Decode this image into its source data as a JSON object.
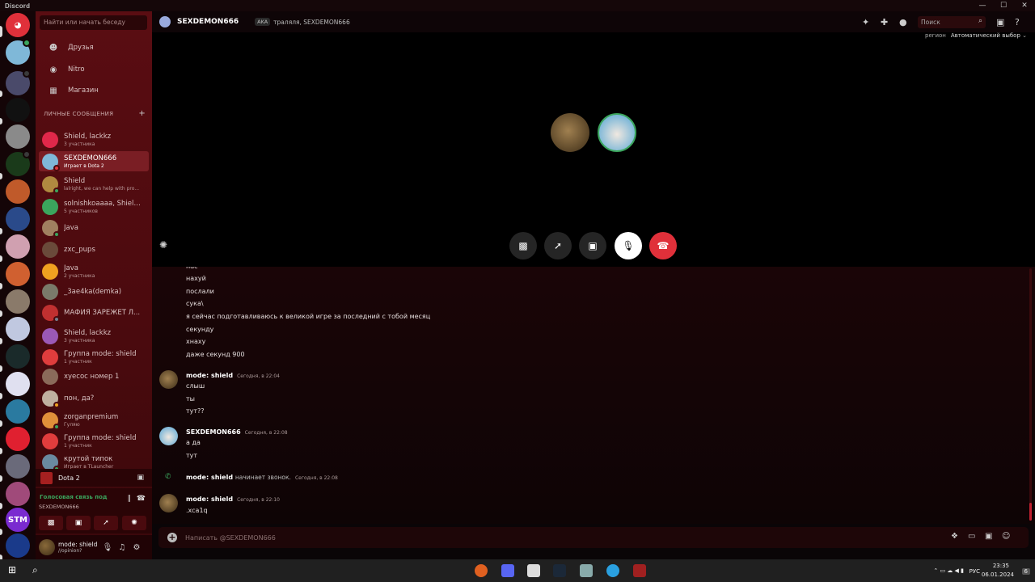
{
  "window": {
    "title": "Discord",
    "controls": [
      "—",
      "☐",
      "✕"
    ]
  },
  "sidebar": {
    "search_placeholder": "Найти или начать беседу",
    "nav": [
      {
        "label": "Друзья",
        "icon": "friends-icon"
      },
      {
        "label": "Nitro",
        "icon": "nitro-icon"
      },
      {
        "label": "Магазин",
        "icon": "shop-icon"
      }
    ],
    "dm_header": "ЛИЧНЫЕ СООБЩЕНИЯ",
    "dms": [
      {
        "name": "Shield, lackkz",
        "sub": "3 участника",
        "color": "#e0284a"
      },
      {
        "name": "SEXDEMON666",
        "sub": "Играет в Dota 2",
        "color": "#7fb8d8",
        "selected": true
      },
      {
        "name": "Shield",
        "sub": "lalright, we can help with pro...",
        "color": "#b08a40"
      },
      {
        "name": "solnishkoaaaa, Shield,...",
        "sub": "5 участников",
        "color": "#3ba55d"
      },
      {
        "name": "Java",
        "sub": "",
        "color": "#a08060"
      },
      {
        "name": "zxc_pups",
        "sub": "",
        "color": "#6a4a3a"
      },
      {
        "name": "Java",
        "sub": "2 участника",
        "color": "#f0a020"
      },
      {
        "name": "_3ae4ka(demka)",
        "sub": "",
        "color": "#7a7a6a"
      },
      {
        "name": "МАФИЯ ЗАРЕЖЕТ Л...",
        "sub": "",
        "color": "#c03030"
      },
      {
        "name": "Shield, lackkz",
        "sub": "3 участника",
        "color": "#9b59b6"
      },
      {
        "name": "Группа mode: shield",
        "sub": "1 участник",
        "color": "#e03d3d"
      },
      {
        "name": "хуесос номер 1",
        "sub": "",
        "color": "#8a6a5a"
      },
      {
        "name": "пон, да?",
        "sub": "",
        "color": "#c0b0a0"
      },
      {
        "name": "zorganpremium",
        "sub": "Гуляю",
        "color": "#e0903a"
      },
      {
        "name": "Группа mode: shield",
        "sub": "1 участник",
        "color": "#e03d3d"
      },
      {
        "name": "крутой типок",
        "sub": "Играет в TLauncher",
        "color": "#6a8aa0"
      }
    ],
    "activity": {
      "game": "Dota 2"
    },
    "voice": {
      "status": "Голосовая связь под",
      "channel": "SEXDEMON666"
    },
    "user": {
      "name": "mode: shield",
      "status": "//opinion?"
    }
  },
  "header": {
    "name": "SEXDEMON666",
    "aka": "AKA",
    "aka_names": "траляля, SEXDEMON666",
    "search": "Поиск"
  },
  "call": {
    "region_label": "регион",
    "region_value": "Автоматический выбор"
  },
  "messages": {
    "lines_top": [
      "нас",
      "нахуй",
      "послали",
      "сука\\",
      "я сейчас подготавливаюсь к великой игре за последний с тобой месяц",
      "секунду",
      "хнаху",
      "даже секунд 900"
    ],
    "m1": {
      "author": "mode: shield",
      "time": "Сегодня, в 22:04",
      "lines": [
        "слыш",
        "ты",
        "тут??"
      ]
    },
    "m2": {
      "author": "SEXDEMON666",
      "time": "Сегодня, в 22:08",
      "lines": [
        "а да",
        "тут"
      ]
    },
    "call_event": {
      "author": "mode: shield",
      "text": "начинает звонок.",
      "time": "Сегодня, в 22:08"
    },
    "m3": {
      "author": "mode: shield",
      "time": "Сегодня, в 22:10",
      "lines": [
        ".xca1q"
      ]
    }
  },
  "input": {
    "placeholder": "Написать @SEXDEMON666"
  },
  "taskbar": {
    "lang": "РУС",
    "time": "23:35",
    "date": "06.01.2024",
    "notif": "6"
  }
}
